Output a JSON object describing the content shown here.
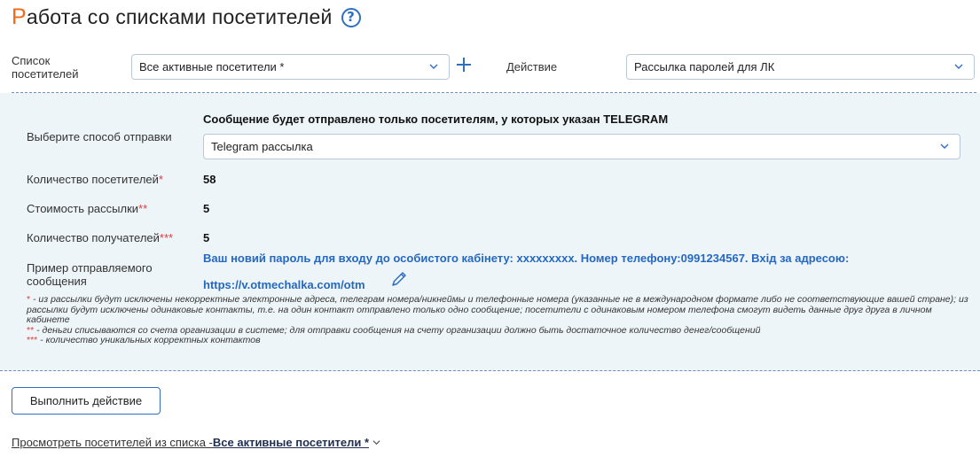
{
  "page": {
    "title_first_letter": "Р",
    "title_rest": "абота со списками посетителей",
    "help_glyph": "?"
  },
  "top_form": {
    "list_label_line1": "Список",
    "list_label_line2": "посетителей",
    "list_value": "Все активные посетители *",
    "action_label": "Действие",
    "action_value": "Рассылка паролей для ЛК"
  },
  "panel": {
    "notice": "Сообщение будет отправлено только посетителям, у которых указан TELEGRAM",
    "send_method_label": "Выберите способ отправки",
    "send_method_value": "Telegram рассылка",
    "visitors_count_label": "Количество посетителей",
    "visitors_count_mark": "*",
    "visitors_count_value": "58",
    "cost_label": "Стоимость рассылки",
    "cost_mark": "**",
    "cost_value": "5",
    "recipients_label": "Количество получателей",
    "recipients_mark": "***",
    "recipients_value": "5",
    "example_label_line1": "Пример отправляемого",
    "example_label_line2": "сообщения",
    "example_text_line1": "Ваш новий пароль для входу до особистого кабінету: xxxxxxxxx. Номер телефону:0991234567. Вхід за адресою:",
    "example_text_line2": "https://v.otmechalka.com/otm"
  },
  "footnotes": {
    "note1_mark": "*",
    "note1_text": " - из рассылки будут исключены некорректные электронные адреса, телеграм номера/никнеймы и телефонные номера (указанные не в международном формате либо не соответствующие вашей стране); из рассылки будут исключены одинаковые контакты, т.е. на один контакт отправлено только одно сообщение; посетители с одинаковым номером телефона смогут видеть данные друг друга в личном кабинете",
    "note2_mark": "**",
    "note2_text": " - деньги списываются со счета организации в системе; для отправки сообщения на счету организации должно быть достаточное количество денег/сообщений",
    "note3_mark": "***",
    "note3_text": " - количество уникальных корректных контактов"
  },
  "actions": {
    "execute_label": "Выполнить действие",
    "view_prefix": "Просмотреть посетителей из списка - ",
    "view_list_name": "Все активные посетители *"
  },
  "colors": {
    "accent": "#2e6fc0",
    "title_letter": "#f26a1b",
    "panel_bg": "#eef5f9",
    "required_mark": "#e23b3b",
    "message_text": "#2568c2"
  },
  "icons": [
    "help-icon",
    "chevron-down-icon",
    "plus-icon",
    "pencil-icon"
  ]
}
